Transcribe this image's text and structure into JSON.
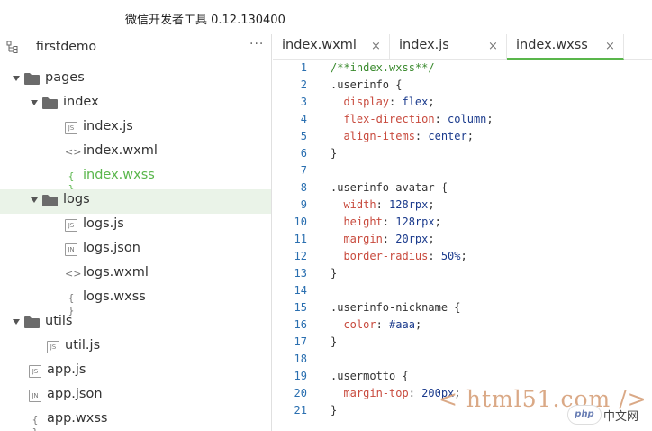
{
  "window": {
    "title": "微信开发者工具 0.12.130400"
  },
  "sidebar": {
    "project_name": "firstdemo",
    "more_label": "···",
    "tree": [
      {
        "label": "pages",
        "kind": "folder",
        "expanded": true,
        "depth": 0
      },
      {
        "label": "index",
        "kind": "folder",
        "expanded": true,
        "depth": 1
      },
      {
        "label": "index.js",
        "kind": "file",
        "icon": "JS",
        "depth": 2
      },
      {
        "label": "index.wxml",
        "kind": "file",
        "icon": "<>",
        "depth": 2
      },
      {
        "label": "index.wxss",
        "kind": "file",
        "icon": "{ }",
        "depth": 2,
        "active": true
      },
      {
        "label": "logs",
        "kind": "folder",
        "expanded": true,
        "depth": 1,
        "selected": true
      },
      {
        "label": "logs.js",
        "kind": "file",
        "icon": "JS",
        "depth": 2
      },
      {
        "label": "logs.json",
        "kind": "file",
        "icon": "JN",
        "depth": 2
      },
      {
        "label": "logs.wxml",
        "kind": "file",
        "icon": "<>",
        "depth": 2
      },
      {
        "label": "logs.wxss",
        "kind": "file",
        "icon": "{ }",
        "depth": 2
      },
      {
        "label": "utils",
        "kind": "folder",
        "expanded": true,
        "depth": 0
      },
      {
        "label": "util.js",
        "kind": "file",
        "icon": "JS",
        "depth": 1
      },
      {
        "label": "app.js",
        "kind": "file",
        "icon": "JS",
        "depth": 0
      },
      {
        "label": "app.json",
        "kind": "file",
        "icon": "JN",
        "depth": 0
      },
      {
        "label": "app.wxss",
        "kind": "file",
        "icon": "{ }",
        "depth": 0
      }
    ]
  },
  "editor": {
    "tabs": [
      {
        "label": "index.wxml",
        "close": "×"
      },
      {
        "label": "index.js",
        "close": "×"
      },
      {
        "label": "index.wxss",
        "close": "×",
        "active": true
      }
    ],
    "lines": [
      {
        "n": "1",
        "tokens": [
          [
            "c-comment",
            "/**index.wxss**/"
          ]
        ]
      },
      {
        "n": "2",
        "tokens": [
          [
            "c-sel",
            ".userinfo {"
          ]
        ]
      },
      {
        "n": "3",
        "tokens": [
          [
            "c-prop",
            "  display"
          ],
          [
            "c-punc",
            ": "
          ],
          [
            "c-val",
            "flex"
          ],
          [
            "c-punc",
            ";"
          ]
        ]
      },
      {
        "n": "4",
        "tokens": [
          [
            "c-prop",
            "  flex-direction"
          ],
          [
            "c-punc",
            ": "
          ],
          [
            "c-val",
            "column"
          ],
          [
            "c-punc",
            ";"
          ]
        ]
      },
      {
        "n": "5",
        "tokens": [
          [
            "c-prop",
            "  align-items"
          ],
          [
            "c-punc",
            ": "
          ],
          [
            "c-val",
            "center"
          ],
          [
            "c-punc",
            ";"
          ]
        ]
      },
      {
        "n": "6",
        "tokens": [
          [
            "c-sel",
            "}"
          ]
        ]
      },
      {
        "n": "7",
        "tokens": []
      },
      {
        "n": "8",
        "tokens": [
          [
            "c-sel",
            ".userinfo-avatar {"
          ]
        ]
      },
      {
        "n": "9",
        "tokens": [
          [
            "c-prop",
            "  width"
          ],
          [
            "c-punc",
            ": "
          ],
          [
            "c-val",
            "128rpx"
          ],
          [
            "c-punc",
            ";"
          ]
        ]
      },
      {
        "n": "10",
        "tokens": [
          [
            "c-prop",
            "  height"
          ],
          [
            "c-punc",
            ": "
          ],
          [
            "c-val",
            "128rpx"
          ],
          [
            "c-punc",
            ";"
          ]
        ]
      },
      {
        "n": "11",
        "tokens": [
          [
            "c-prop",
            "  margin"
          ],
          [
            "c-punc",
            ": "
          ],
          [
            "c-val",
            "20rpx"
          ],
          [
            "c-punc",
            ";"
          ]
        ]
      },
      {
        "n": "12",
        "tokens": [
          [
            "c-prop",
            "  border-radius"
          ],
          [
            "c-punc",
            ": "
          ],
          [
            "c-val",
            "50%"
          ],
          [
            "c-punc",
            ";"
          ]
        ]
      },
      {
        "n": "13",
        "tokens": [
          [
            "c-sel",
            "}"
          ]
        ]
      },
      {
        "n": "14",
        "tokens": []
      },
      {
        "n": "15",
        "tokens": [
          [
            "c-sel",
            ".userinfo-nickname {"
          ]
        ]
      },
      {
        "n": "16",
        "tokens": [
          [
            "c-prop",
            "  color"
          ],
          [
            "c-punc",
            ": "
          ],
          [
            "c-val",
            "#aaa"
          ],
          [
            "c-punc",
            ";"
          ]
        ]
      },
      {
        "n": "17",
        "tokens": [
          [
            "c-sel",
            "}"
          ]
        ]
      },
      {
        "n": "18",
        "tokens": []
      },
      {
        "n": "19",
        "tokens": [
          [
            "c-sel",
            ".usermotto {"
          ]
        ]
      },
      {
        "n": "20",
        "tokens": [
          [
            "c-prop",
            "  margin-top"
          ],
          [
            "c-punc",
            ": "
          ],
          [
            "c-val",
            "200px"
          ],
          [
            "c-punc",
            ";"
          ]
        ]
      },
      {
        "n": "21",
        "tokens": [
          [
            "c-sel",
            "}"
          ]
        ]
      }
    ]
  },
  "watermark": {
    "text": "< html51.com />",
    "badge_logo": "php",
    "badge_text": "中文网"
  },
  "colors": {
    "accent": "#59b64b",
    "line_number": "#2a6fb0",
    "comment": "#3a8a2e",
    "property": "#c84a3d",
    "value": "#1a3a8c"
  }
}
